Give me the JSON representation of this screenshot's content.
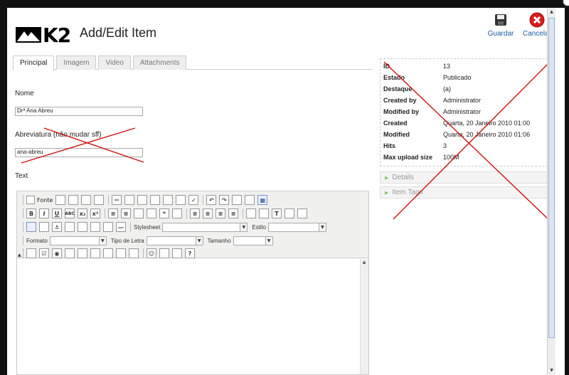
{
  "header": {
    "title": "Add/Edit Item",
    "logo_text": "K2",
    "save_label": "Guardar",
    "cancel_label": "Cancelar"
  },
  "tabs": [
    {
      "label": "Principal",
      "active": true
    },
    {
      "label": "Imagem",
      "active": false
    },
    {
      "label": "Video",
      "active": false
    },
    {
      "label": "Attachments",
      "active": false
    }
  ],
  "form": {
    "name_label": "Nome",
    "name_value": "Drª Ana Abreu",
    "alias_label": "Abreviatura (não mudar sff)",
    "alias_value": "ana-abreu",
    "text_label": "Text"
  },
  "editor": {
    "fonte_label": "Fonte",
    "stylesheet_label": "Stylesheet",
    "estilo_label": "Estilo",
    "formato_label": "Formato",
    "tipo_letra_label": "Tipo de Letra",
    "tamanho_label": "Tamanho"
  },
  "info": [
    {
      "key": "ID",
      "value": "13"
    },
    {
      "key": "Estado",
      "value": "Publicado"
    },
    {
      "key": "Destaque",
      "value": "(a)"
    },
    {
      "key": "Created by",
      "value": "Administrator"
    },
    {
      "key": "Modified by",
      "value": "Administrator"
    },
    {
      "key": "Created",
      "value": "Quarta, 20 Janeiro 2010 01:00"
    },
    {
      "key": "Modified",
      "value": "Quarta, 20 Janeiro 2010 01:06"
    },
    {
      "key": "Hits",
      "value": "3"
    },
    {
      "key": "Max upload size",
      "value": "100M"
    }
  ],
  "panels": {
    "details_label": "Details",
    "item_tags_label": "Item Tags"
  },
  "colors": {
    "annotation_red": "#d01010",
    "link_blue": "#1a5aa0",
    "toolbar_bg": "#f0f0ee"
  }
}
